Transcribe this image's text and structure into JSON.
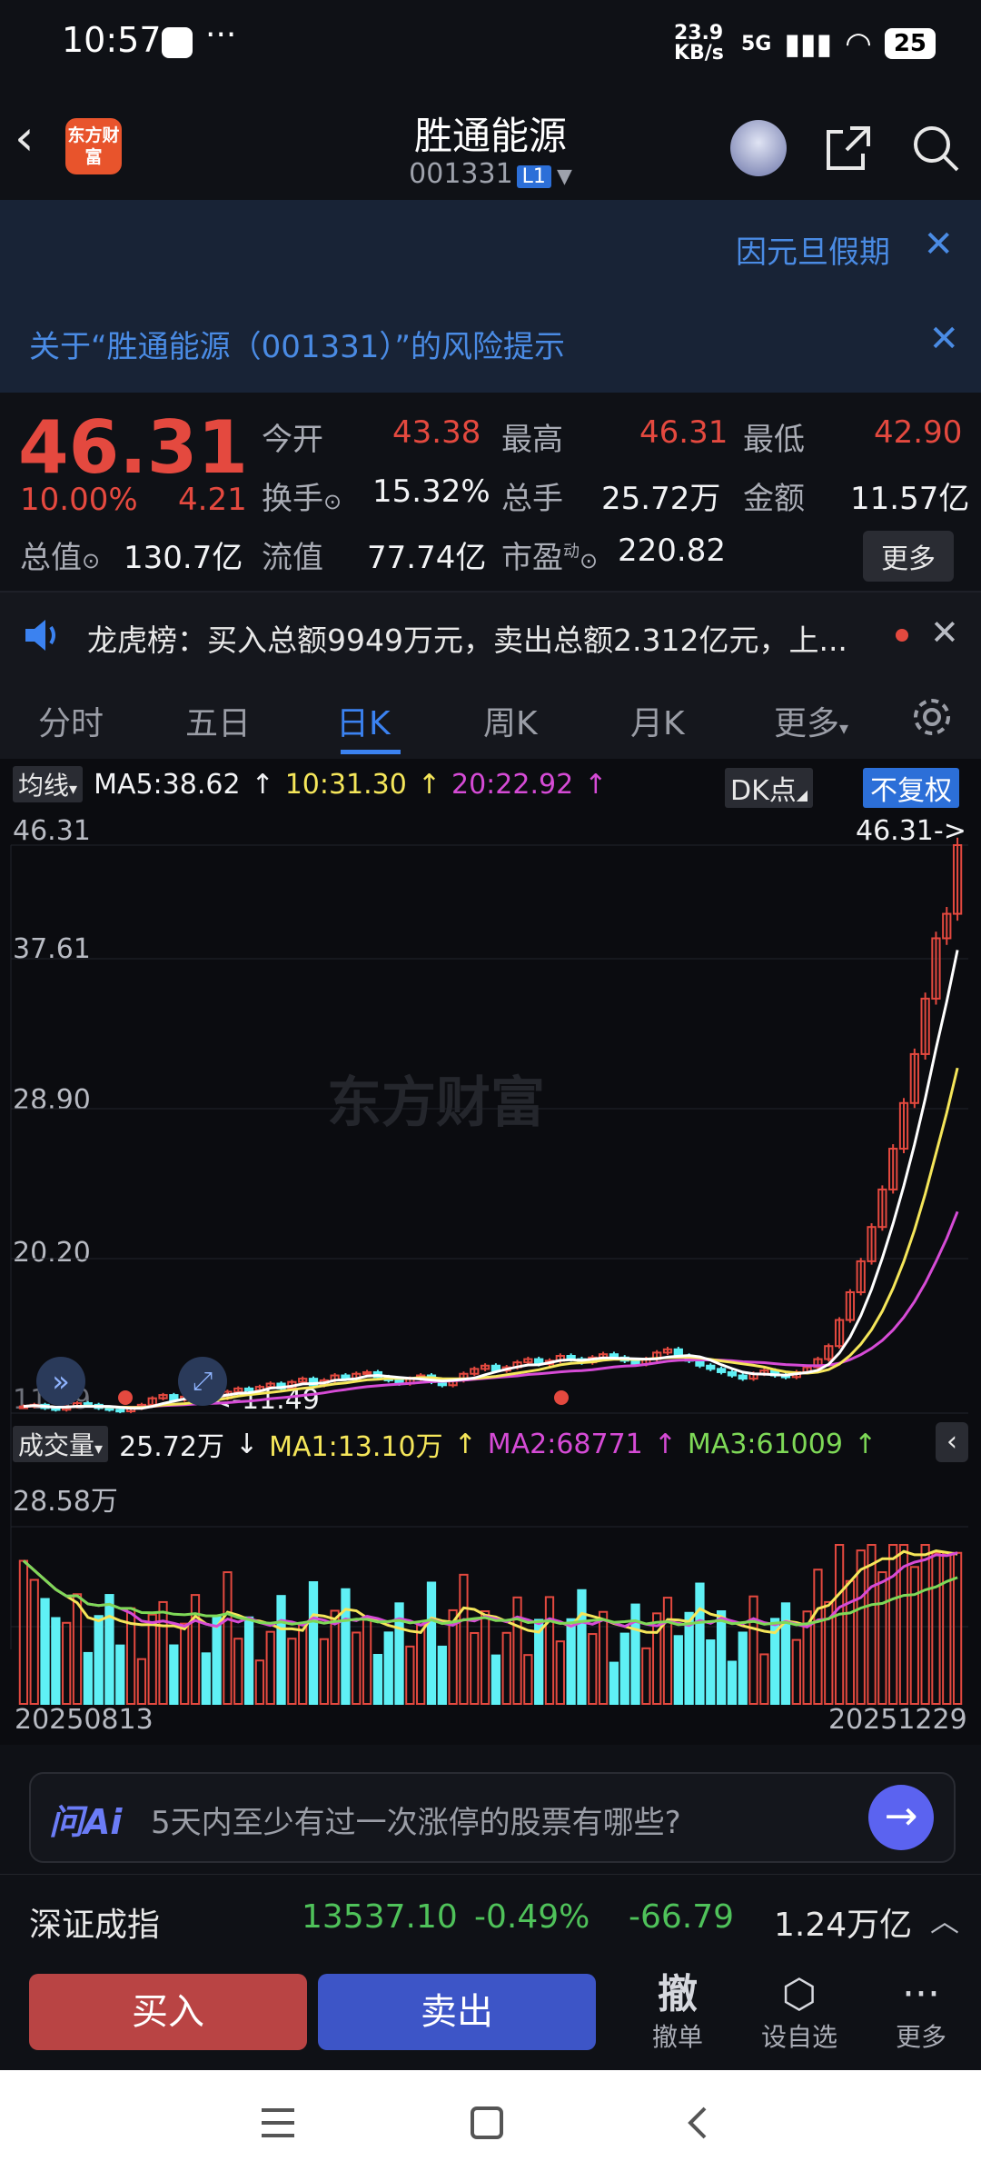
{
  "status_bar": {
    "time": "10:57",
    "net_speed": "23.9 KB/s",
    "network": "5G",
    "battery": "25"
  },
  "header": {
    "title": "胜通能源",
    "code": "001331",
    "level": "L1",
    "logo_text": "东方财富"
  },
  "notices": {
    "holiday": "因元旦假期",
    "risk": "关于“胜通能源（001331）”的风险提示"
  },
  "quote": {
    "price": "46.31",
    "change_pct": "10.00%",
    "change": "4.21",
    "open_label": "今开",
    "open": "43.38",
    "high_label": "最高",
    "high": "46.31",
    "low_label": "最低",
    "low": "42.90",
    "turnover_label": "换手",
    "turnover": "15.32%",
    "volume_label": "总手",
    "volume": "25.72万",
    "amount_label": "金额",
    "amount": "11.57亿",
    "mktcap_label": "总值",
    "mktcap": "130.7亿",
    "float_label": "流值",
    "float": "77.74亿",
    "pe_label": "市盈",
    "pe_sup": "动",
    "pe": "220.82",
    "more_label": "更多"
  },
  "dragon_list": {
    "text": "龙虎榜：买入总额9949万元，卖出总额2.312亿元，上..."
  },
  "tabs": [
    {
      "label": "分时"
    },
    {
      "label": "五日"
    },
    {
      "label": "日K"
    },
    {
      "label": "周K"
    },
    {
      "label": "月K"
    },
    {
      "label": "更多"
    }
  ],
  "kline": {
    "indicator_label": "均线",
    "ma5": "MA5:38.62",
    "ma10": "10:31.30",
    "ma20": "20:22.92",
    "dk_label": "DK点",
    "fq_label": "不复权",
    "y_labels": [
      "46.31",
      "37.61",
      "28.90",
      "20.20"
    ],
    "last_price_label": "46.31->",
    "low_marker": "11.49",
    "low_axis_label": "11.49",
    "watermark": "东方财富"
  },
  "volume": {
    "label": "成交量",
    "value": "25.72万",
    "ma1": "MA1:13.10万",
    "ma2": "MA2:68771",
    "ma3": "MA3:61009",
    "max_label": "28.58万",
    "start_date": "20250813",
    "end_date": "20251229"
  },
  "ai_bar": {
    "logo": "问Ai",
    "prompt": "5天内至少有过一次涨停的股票有哪些?"
  },
  "index_bar": {
    "name": "深证成指",
    "value": "13537.10",
    "pct": "-0.49%",
    "change": "-66.79",
    "amount": "1.24万亿"
  },
  "trade_bar": {
    "buy": "买入",
    "sell": "卖出",
    "cancel_icon": "撤",
    "cancel": "撤单",
    "watch": "设自选",
    "more": "更多"
  },
  "colors": {
    "up": "#e4493f",
    "down": "#5ff0f5",
    "accent": "#3b82f0",
    "ma5": "#ffffff",
    "ma10": "#f5e65a",
    "ma20": "#d64bd6",
    "vol_ma3": "#7ed957"
  },
  "chart_data": {
    "type": "candlestick",
    "y_axis_labels": [
      "46.31",
      "37.61",
      "28.90",
      "20.20",
      "11.49"
    ],
    "start_date": "20250813",
    "end_date": "20251229",
    "close_series": [
      11.9,
      12.0,
      11.8,
      11.7,
      11.9,
      12.1,
      12.0,
      11.8,
      11.7,
      11.6,
      11.8,
      12.0,
      12.4,
      12.6,
      12.3,
      12.5,
      12.7,
      12.6,
      12.4,
      12.8,
      13.0,
      12.9,
      13.1,
      13.3,
      13.0,
      13.4,
      13.6,
      13.2,
      13.5,
      13.8,
      13.6,
      13.9,
      14.0,
      13.7,
      13.5,
      13.3,
      13.6,
      13.8,
      13.4,
      13.2,
      13.5,
      13.9,
      14.2,
      14.4,
      14.1,
      14.3,
      14.6,
      14.8,
      14.5,
      14.7,
      15.0,
      14.8,
      14.6,
      14.9,
      15.1,
      14.9,
      14.7,
      14.5,
      14.8,
      15.2,
      15.4,
      15.0,
      14.7,
      14.4,
      14.2,
      14.0,
      13.8,
      13.6,
      13.9,
      14.1,
      13.8,
      13.7,
      14.0,
      14.3,
      14.8,
      15.6,
      17.2,
      18.9,
      20.8,
      22.9,
      25.2,
      27.7,
      30.5,
      33.5,
      36.9,
      40.6,
      42.1,
      46.31
    ],
    "ma5_label": "MA5:38.62",
    "ma10_label": "10:31.30",
    "ma20_label": "20:22.92"
  }
}
